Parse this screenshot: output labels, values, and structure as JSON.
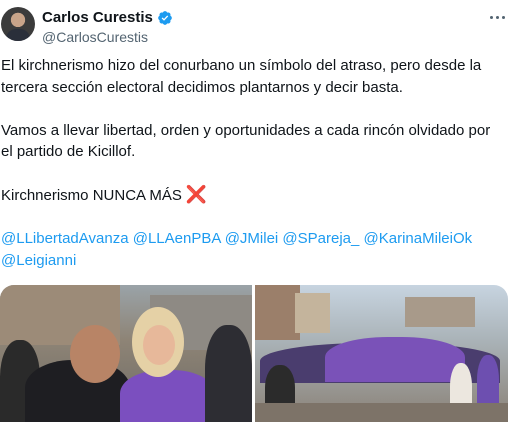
{
  "tweet": {
    "author_name": "Carlos Curestis",
    "author_handle": "@CarlosCurestis",
    "paragraphs": [
      "El kirchnerismo hizo del conurbano un símbolo del atraso, pero desde la tercera sección electoral decidimos plantarnos y decir basta.",
      "Vamos a llevar libertad, orden y oportunidades a cada rincón olvidado por el partido de Kicillof.",
      "Kirchnerismo NUNCA MÁS"
    ],
    "emoji": "❌",
    "mentions": [
      "@LLibertadAvanza",
      "@LLAenPBA",
      "@JMilei",
      "@SPareja_",
      "@KarinaMileiOk",
      "@Leigianni"
    ]
  },
  "icons": {
    "verified": "verified-badge-icon",
    "more": "more-options-icon",
    "cross": "cross-mark-icon"
  },
  "colors": {
    "link": "#1d9bf0",
    "verified": "#1d9bf0",
    "text": "#0f1419",
    "secondary": "#536471",
    "cross": "#dd2e44"
  }
}
